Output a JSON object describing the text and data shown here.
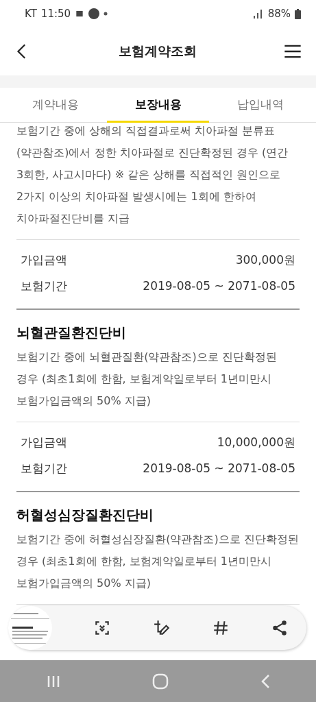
{
  "status_bar": {
    "carrier": "KT",
    "time": "11:50",
    "battery": "88%"
  },
  "header": {
    "title": "보험계약조회"
  },
  "tabs": [
    {
      "label": "계약내용",
      "selected": false
    },
    {
      "label": "보장내용",
      "selected": true
    },
    {
      "label": "납입내역",
      "selected": false
    }
  ],
  "coverages": [
    {
      "description": "보험기간 중에 상해의 직접결과로써 치아파절 분류표 (약관참조)에서 정한 치아파절로 진단확정된 경우 (연간 3회한, 사고시마다) ※ 같은 상해를 직접적인 원인으로 2가지 이상의 치아파절 발생시에는 1회에 한하여 치아파절진단비를 지급",
      "rows": [
        {
          "label": "가입금액",
          "value": "300,000원"
        },
        {
          "label": "보험기간",
          "value": "2019-08-05 ~ 2071-08-05"
        }
      ]
    },
    {
      "title": "뇌혈관질환진단비",
      "description": "보험기간 중에 뇌혈관질환(약관참조)으로 진단확정된 경우 (최초1회에 한함, 보험계약일로부터 1년미만시 보험가입금액의 50% 지급)",
      "rows": [
        {
          "label": "가입금액",
          "value": "10,000,000원"
        },
        {
          "label": "보험기간",
          "value": "2019-08-05 ~ 2071-08-05"
        }
      ]
    },
    {
      "title": "허혈성심장질환진단비",
      "description": "보험기간 중에 허혈성심장질환(약관참조)으로 진단확정된 경우 (최초1회에 한함, 보험계약일로부터 1년미만시 보험가입금액의 50% 지급)"
    }
  ]
}
